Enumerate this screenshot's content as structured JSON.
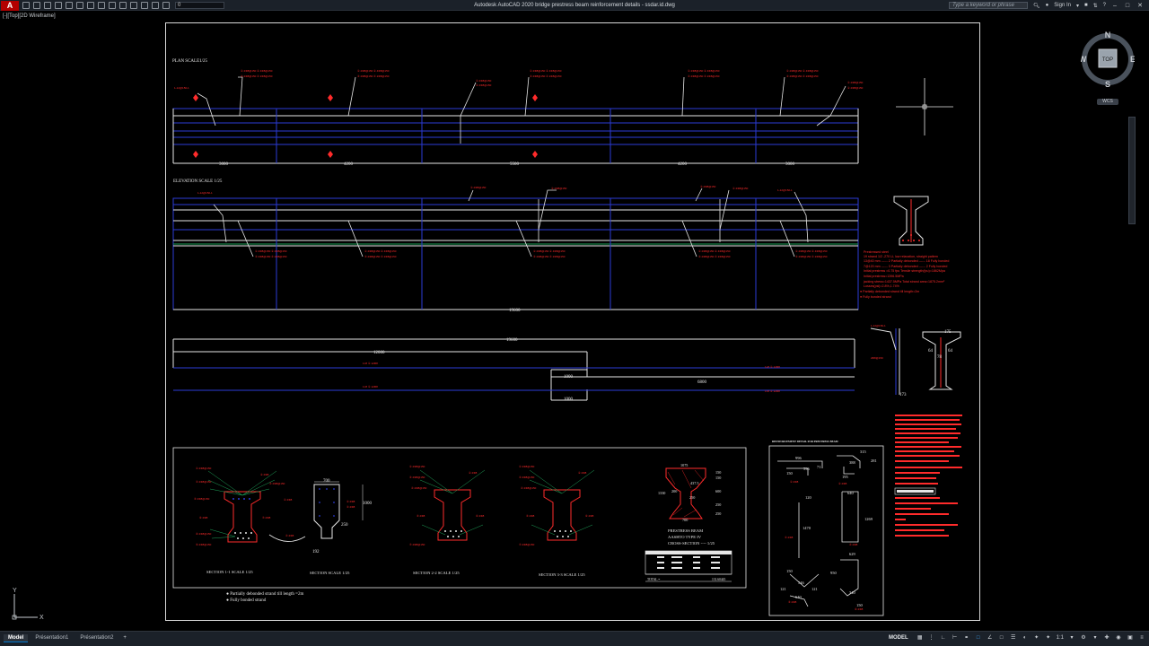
{
  "app": {
    "title": "Autodesk AutoCAD 2020   bridge prestress beam reinforcement details - ssdar.id.dwg",
    "menu_button": "A",
    "layer_value": "0",
    "search_placeholder": "Type a keyword or phrase",
    "sign_in": "Sign In",
    "help": "?",
    "brand_color": "#b30000"
  },
  "viewport": {
    "label": "[-][Top][2D Wireframe]"
  },
  "drawing": {
    "plan_title": "PLAN   SCALE1/25",
    "elevation_title": "ELEVATION SCALE 1/25",
    "plan_dims": [
      "3000",
      "4200",
      "5500",
      "4200",
      "3000"
    ],
    "elev_total": "19600",
    "strand_total": "19600",
    "strand_dims": [
      "12000",
      "1000",
      "6800",
      "1000"
    ],
    "section_titles": [
      "SECTION 1-1 SCALE 1/25",
      "SECTION SCALE 1/25",
      "SECTION 2-2  SCALE 1/25",
      "SECTION 3-3 SCALE 1/25"
    ],
    "section_dims": [
      "700",
      "1000",
      "250",
      "192"
    ],
    "beam_title_lines": [
      "PRESTRESS BEAM",
      "AASHTO TYPE  IV",
      "CROSS-SECTION ---- 1/25"
    ],
    "beam_dims": [
      "1075",
      "150",
      "150",
      "437.5",
      "1330",
      "200",
      "600",
      "250",
      "250",
      "700"
    ],
    "table_total": "TOTAL =",
    "table_value": "131.60445",
    "legend": [
      "● Partially debonded strand till length =2m",
      "● Fully bonded strand"
    ],
    "side_section_dims": [
      "175",
      "64",
      "64",
      "78",
      "173"
    ],
    "detail_title": "REINFORCEMENT DETAIL FOR PRESTRESS BEAM",
    "detail_dims": [
      "996",
      "596",
      "71",
      "150",
      "315",
      "388",
      "281",
      "195",
      "120",
      "640",
      "1470",
      "1269",
      "150",
      "546",
      "121",
      "121",
      "640",
      "629",
      "950",
      "340",
      "150"
    ],
    "notes_red": [
      "Prestressed steel",
      "19 strand    1/2 -270 LL  low relaxation,  straight pattern",
      "13@40 mm ------ 2  Partially debonded ------ 18 Fully bonded",
      "7@120 mm ------ 3  Partially debonded ------ 2  Fully bonded",
      "Initial prestress =0.75 fpu        Tensile strength(fpu)=1862Mpa",
      "Initial prestress=1396.5MPa",
      "jacking stress=1437.5MPa     Total strand area=1875.2mm²",
      "Losses(psi)=2.8%,1.74%",
      "● Partially debonded strand till length=2m",
      "● Fully bonded strand"
    ]
  },
  "viewcube": {
    "north": "N",
    "south": "S",
    "east": "E",
    "west": "W",
    "face": "TOP",
    "wcs": "WCS"
  },
  "ucs": {
    "x": "X",
    "y": "Y"
  },
  "statusbar": {
    "tabs": [
      "Model",
      "Présentation1",
      "Présentation2"
    ],
    "add_tab": "+",
    "model_label": "MODEL",
    "scale": "1:1"
  },
  "colors": {
    "drawing_bg": "#000000",
    "white_line": "#e6e6e6",
    "blue_line": "#2b3bd6",
    "red_annot": "#ff2b2b",
    "green_hatch": "#1fa35a"
  }
}
